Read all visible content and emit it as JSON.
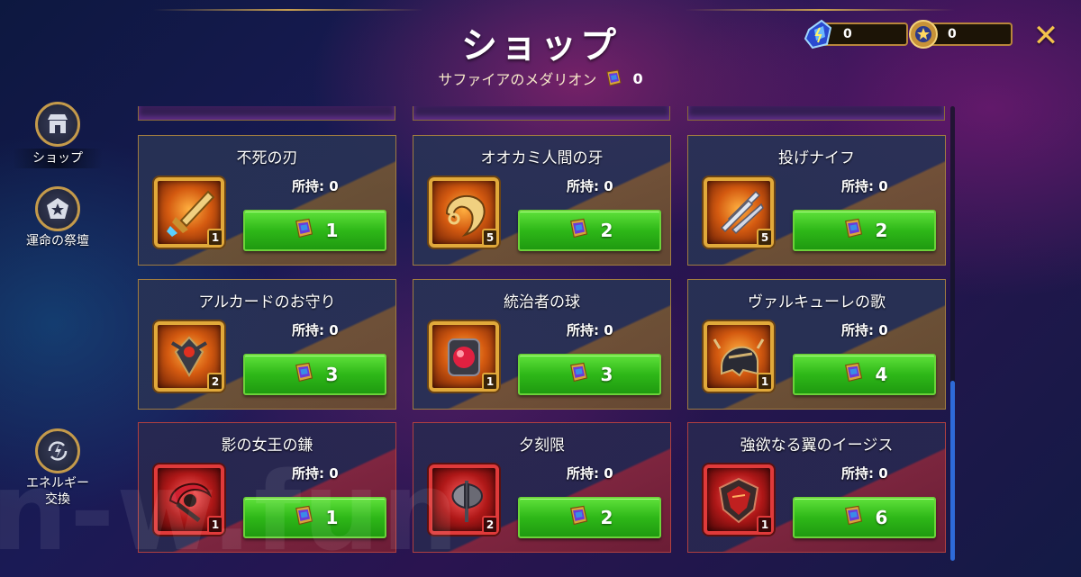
{
  "header": {
    "title": "ショップ",
    "subtitle": "サファイアのメダリオン",
    "medallion_count": "0"
  },
  "currencies": [
    {
      "icon": "energy-crystal-icon",
      "value": "0"
    },
    {
      "icon": "medal-icon",
      "value": "0"
    }
  ],
  "sidebar": {
    "items": [
      {
        "label": "ショップ",
        "icon": "shop-icon",
        "active": true
      },
      {
        "label": "運命の祭壇",
        "icon": "star-altar-icon",
        "active": false
      },
      {
        "label": "エネルギー交換",
        "icon": "energy-exchange-icon",
        "active": false
      }
    ]
  },
  "owned_label": "所持: 0",
  "items": [
    {
      "name": "不死の刃",
      "owned": "所持: 0",
      "qty": "1",
      "price": "1",
      "tier": "gold",
      "icon": "sword-icon"
    },
    {
      "name": "オオカミ人間の牙",
      "owned": "所持: 0",
      "qty": "5",
      "price": "2",
      "tier": "gold",
      "icon": "fang-icon"
    },
    {
      "name": "投げナイフ",
      "owned": "所持: 0",
      "qty": "5",
      "price": "2",
      "tier": "gold",
      "icon": "knives-icon"
    },
    {
      "name": "アルカードのお守り",
      "owned": "所持: 0",
      "qty": "2",
      "price": "3",
      "tier": "gold",
      "icon": "amulet-icon"
    },
    {
      "name": "統治者の球",
      "owned": "所持: 0",
      "qty": "1",
      "price": "3",
      "tier": "gold",
      "icon": "orb-icon"
    },
    {
      "name": "ヴァルキューレの歌",
      "owned": "所持: 0",
      "qty": "1",
      "price": "4",
      "tier": "gold",
      "icon": "helmet-icon"
    },
    {
      "name": "影の女王の鎌",
      "owned": "所持: 0",
      "qty": "1",
      "price": "1",
      "tier": "red",
      "icon": "scythe-icon"
    },
    {
      "name": "夕刻限",
      "owned": "所持: 0",
      "qty": "2",
      "price": "2",
      "tier": "red",
      "icon": "axe-icon"
    },
    {
      "name": "強欲なる翼のイージス",
      "owned": "所持: 0",
      "qty": "1",
      "price": "6",
      "tier": "red",
      "icon": "shield-icon"
    }
  ],
  "watermark": "n-w.fun",
  "colors": {
    "gold_border": "#e1a93a",
    "red_border": "#e03a3a",
    "buy_green": "#2eb818",
    "close_gold": "#f3c24c"
  }
}
